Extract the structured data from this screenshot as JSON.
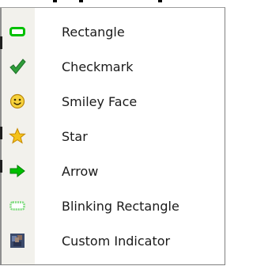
{
  "menu": {
    "items": [
      {
        "label": "Rectangle",
        "icon": "rectangle-icon"
      },
      {
        "label": "Checkmark",
        "icon": "checkmark-icon"
      },
      {
        "label": "Smiley Face",
        "icon": "smiley-face-icon"
      },
      {
        "label": "Star",
        "icon": "star-icon"
      },
      {
        "label": "Arrow",
        "icon": "arrow-icon"
      },
      {
        "label": "Blinking Rectangle",
        "icon": "blinking-rectangle-icon"
      },
      {
        "label": "Custom Indicator",
        "icon": "custom-indicator-icon"
      }
    ]
  },
  "colors": {
    "green": "#00c000",
    "check_green": "#2f9e3a",
    "smiley_yellow": "#f7d23b",
    "star_yellow": "#f4c21b",
    "gutter": "#f2f1ec"
  }
}
